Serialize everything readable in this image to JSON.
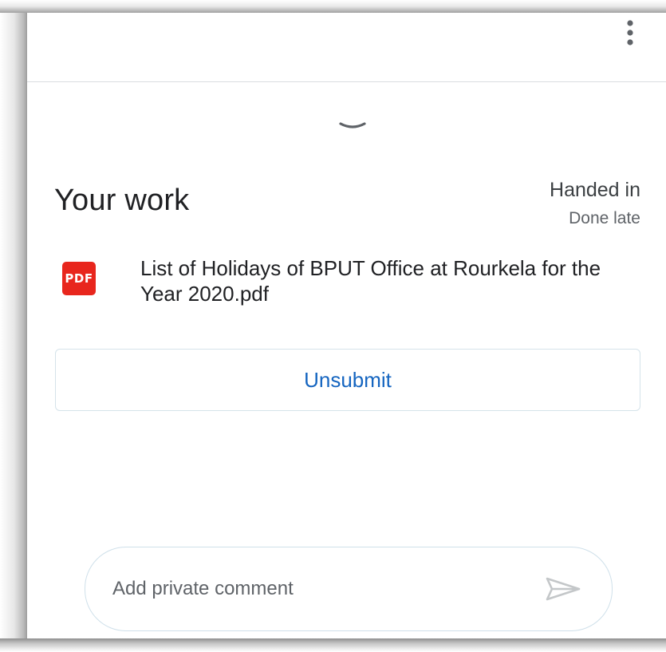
{
  "header": {
    "menu_icon": "more-vert-icon"
  },
  "sheet": {
    "handle_icon": "chevron-down-icon"
  },
  "work": {
    "title": "Your work",
    "status": "Handed in",
    "status_detail": "Done late"
  },
  "attachment": {
    "icon": "pdf-icon",
    "icon_text": "PDF",
    "icon_color": "#e8261d",
    "file_name": "List of Holidays of BPUT Office at Rourkela for the Year 2020.pdf"
  },
  "actions": {
    "unsubmit_label": "Unsubmit",
    "accent_color": "#1565c0"
  },
  "comment": {
    "placeholder": "Add private comment",
    "value": "",
    "send_icon": "send-icon"
  }
}
